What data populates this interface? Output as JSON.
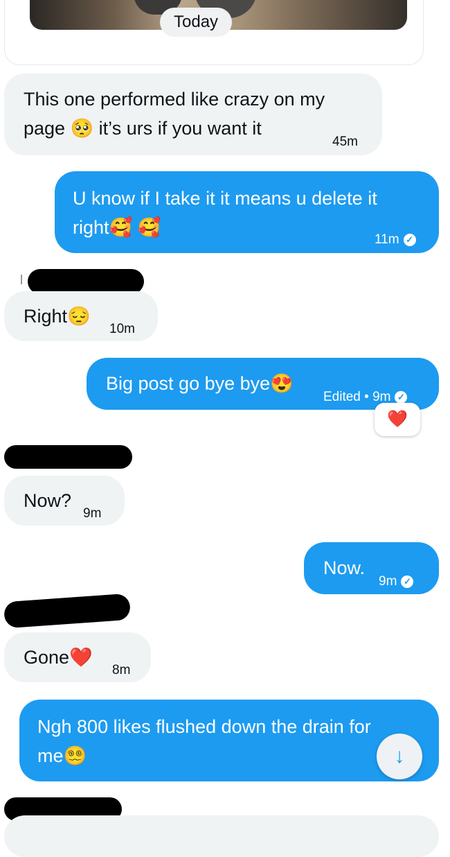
{
  "header": {
    "date_divider": "Today"
  },
  "messages": [
    {
      "text": "This one performed like crazy on my page 🥺 it’s urs if you want it",
      "line1": "This one performed like crazy on my",
      "line2": "page 🥺 it’s urs if you want it",
      "time": "45m"
    },
    {
      "line1": "U know if I take it it means u delete it",
      "line2": "right🥰 🥰",
      "time": "11m"
    },
    {
      "text": "Right😔",
      "time": "10m"
    },
    {
      "text": "Big post go bye bye😍",
      "time": "Edited • 9m",
      "reaction": "❤️"
    },
    {
      "text": "Now?",
      "time": "9m"
    },
    {
      "text": "Now.",
      "time": "9m"
    },
    {
      "text": "Gone❤️",
      "time": "8m"
    },
    {
      "line1": "Ngh 800 likes flushed down the drain for",
      "line2": "me😵‍💫"
    }
  ],
  "icons": {
    "sent_check": "check-circle-icon",
    "scroll_down": "arrow-down-icon"
  },
  "colors": {
    "outgoing": "#1d9bf0",
    "incoming": "#eff3f4"
  }
}
